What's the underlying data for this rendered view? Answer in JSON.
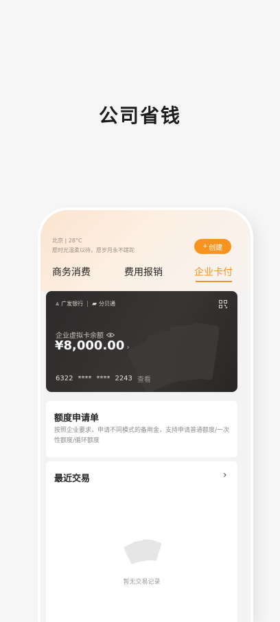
{
  "headline": "公司省钱",
  "header": {
    "location": "北京 | 28°C",
    "greeting": "愿时光温柔以待，愿岁月永不蹉跎",
    "create_label": "创建"
  },
  "tabs": [
    {
      "label": "商务消费",
      "active": false
    },
    {
      "label": "费用报销",
      "active": false
    },
    {
      "label": "企业卡付",
      "active": true
    }
  ],
  "card": {
    "bank_name": "广发银行",
    "partner_name": "分贝通",
    "balance_label": "企业虚拟卡余额",
    "balance": "¥8,000.00",
    "number_start": "6322",
    "mask1": "****",
    "mask2": "****",
    "number_end": "2243",
    "view_label": "查看"
  },
  "quota": {
    "title": "额度申请单",
    "description": "按照企业要求，申请不同模式的备用金，支持申请普通额度/一次性额度/循环额度"
  },
  "transactions": {
    "title": "最近交易",
    "empty_text": "暂无交易记录"
  },
  "colors": {
    "accent": "#f7931e",
    "card_bg": "#2c2a2a",
    "page_bg": "#f6f6f6"
  }
}
